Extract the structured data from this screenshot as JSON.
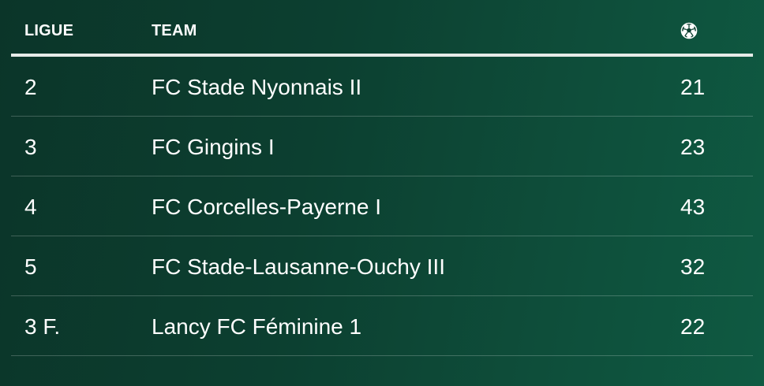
{
  "table": {
    "headers": {
      "league": "LIGUE",
      "team": "TEAM",
      "count_icon": "soccer-ball-icon"
    },
    "rows": [
      {
        "league": "2",
        "team": "FC Stade Nyonnais II",
        "count": "21"
      },
      {
        "league": "3",
        "team": "FC Gingins I",
        "count": "23"
      },
      {
        "league": "4",
        "team": "FC Corcelles-Payerne I",
        "count": "43"
      },
      {
        "league": "5",
        "team": "FC Stade-Lausanne-Ouchy III",
        "count": "32"
      },
      {
        "league": "3 F.",
        "team": "Lancy FC Féminine 1",
        "count": "22"
      }
    ]
  },
  "colors": {
    "background_start": "#0b3529",
    "background_end": "#0f5a42",
    "text": "#ffffff",
    "header_rule": "#e6ebe8"
  }
}
